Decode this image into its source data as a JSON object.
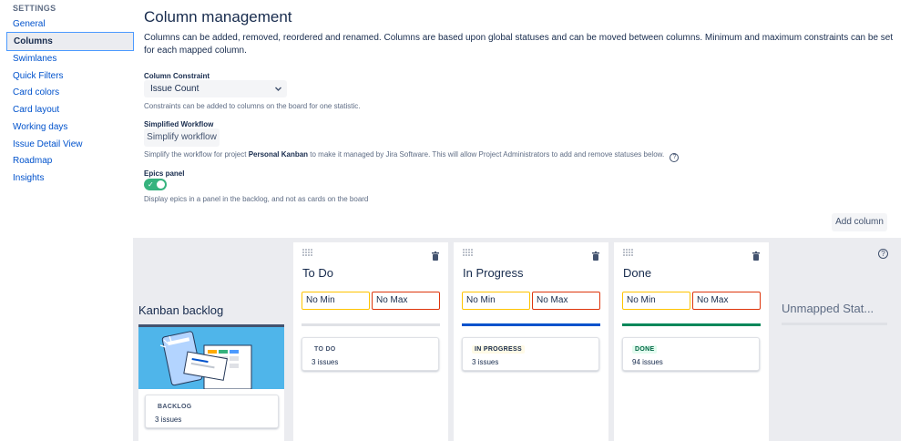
{
  "sidebar": {
    "heading": "SETTINGS",
    "items": [
      {
        "label": "General"
      },
      {
        "label": "Columns"
      },
      {
        "label": "Swimlanes"
      },
      {
        "label": "Quick Filters"
      },
      {
        "label": "Card colors"
      },
      {
        "label": "Card layout"
      },
      {
        "label": "Working days"
      },
      {
        "label": "Issue Detail View"
      },
      {
        "label": "Roadmap"
      },
      {
        "label": "Insights"
      }
    ],
    "active_index": 1
  },
  "main": {
    "title": "Column management",
    "description": "Columns can be added, removed, reordered and renamed. Columns are based upon global statuses and can be moved between columns. Minimum and maximum constraints can be set for each mapped column.",
    "column_constraint": {
      "label": "Column Constraint",
      "value": "Issue Count",
      "help": "Constraints can be added to columns on the board for one statistic."
    },
    "simplified_workflow": {
      "label": "Simplified Workflow",
      "button": "Simplify workflow",
      "help_prefix": "Simplify the workflow for project ",
      "project": "Personal Kanban",
      "help_suffix": " to make it managed by Jira Software. This will allow Project Administrators to add and remove statuses below."
    },
    "epics_panel": {
      "label": "Epics panel",
      "enabled": true,
      "help": "Display epics in a panel in the backlog, and not as cards on the board"
    },
    "add_column_button": "Add column"
  },
  "board": {
    "backlog": {
      "title": "Kanban backlog",
      "status": "BACKLOG",
      "count": "3 issues"
    },
    "columns": [
      {
        "title": "To Do",
        "min_placeholder": "No Min",
        "max_placeholder": "No Max",
        "status": "TO DO",
        "count": "3 issues",
        "bar_color": "#dfe1e6",
        "lozenge_bg": "#ffffff",
        "lozenge_color": "#42526e"
      },
      {
        "title": "In Progress",
        "min_placeholder": "No Min",
        "max_placeholder": "No Max",
        "status": "IN PROGRESS",
        "count": "3 issues",
        "bar_color": "#0052cc",
        "lozenge_bg": "#fffae6",
        "lozenge_color": "#172b4d"
      },
      {
        "title": "Done",
        "min_placeholder": "No Min",
        "max_placeholder": "No Max",
        "status": "DONE",
        "count": "94 issues",
        "bar_color": "#00875a",
        "lozenge_bg": "#e3fcef",
        "lozenge_color": "#006644"
      }
    ],
    "unmapped": {
      "title": "Unmapped Stat..."
    }
  },
  "icons": {
    "help": "question-circle-icon",
    "trash": "trash-icon",
    "drag": "drag-handle-icon",
    "chevron": "chevron-down-icon",
    "check": "check-icon"
  }
}
